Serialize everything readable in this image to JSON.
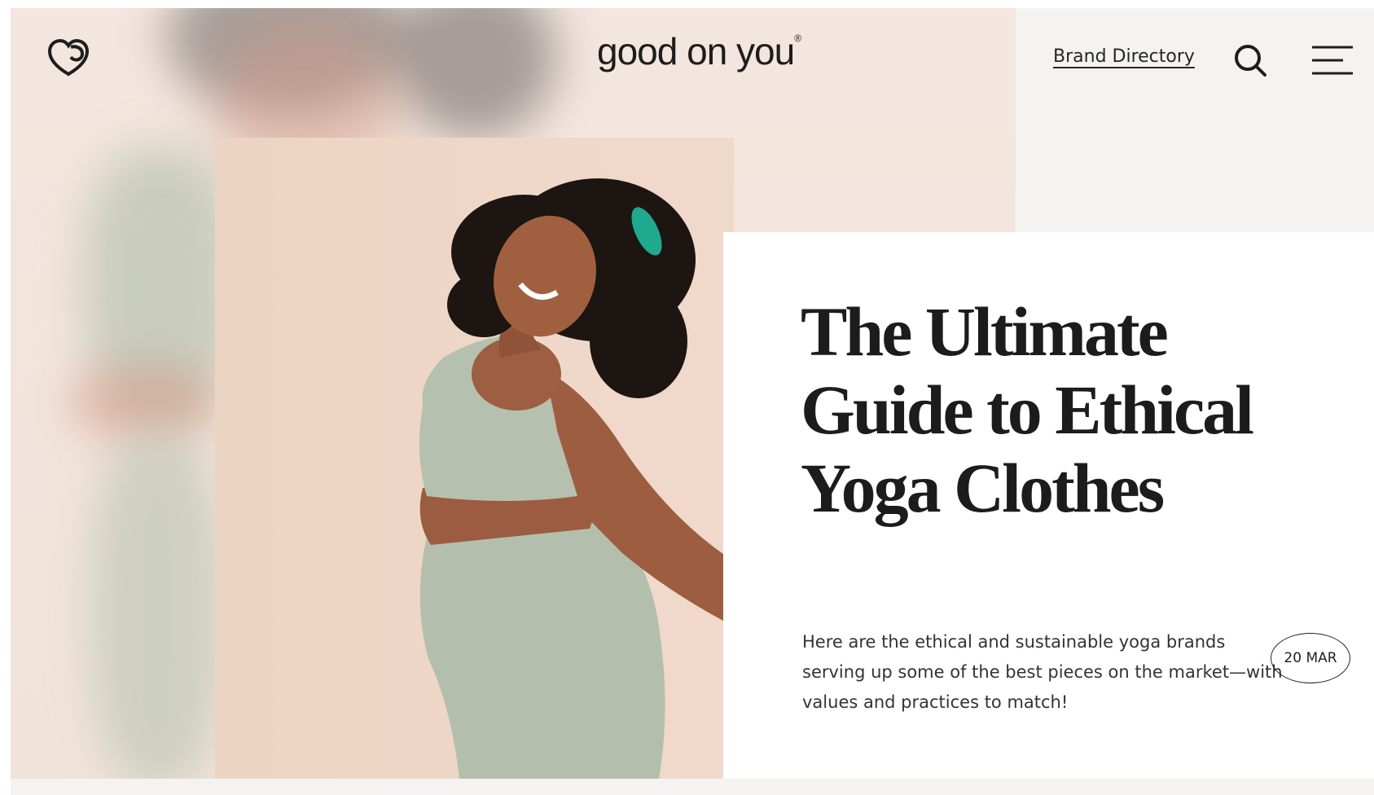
{
  "header": {
    "brand": "good on you",
    "brand_mark": "®",
    "nav_link": "Brand Directory",
    "logo_icon": "heart-logo-icon",
    "search_icon": "search-icon",
    "menu_icon": "hamburger-menu-icon"
  },
  "article": {
    "title": "The Ultimate Guide to Ethical Yoga Clothes",
    "excerpt": "Here are the ethical and sustainable yoga brands serving up some of the best pieces on the market—with values and practices to match!",
    "date": "20 MAR"
  },
  "colors": {
    "page_bg": "#f4f3f2",
    "text": "#1c1c1c",
    "photo_bg": "#efd7c8",
    "outfit": "#b3bfac",
    "scrunchie": "#1fa98f"
  }
}
